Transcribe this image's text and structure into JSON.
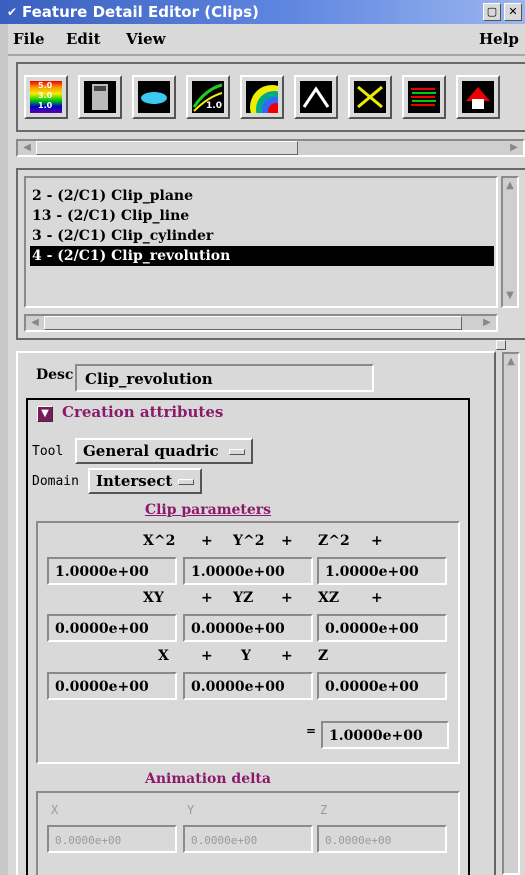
{
  "window": {
    "title": "Feature Detail Editor (Clips)",
    "menu_glyph": "✔",
    "minimize_glyph": "▢",
    "close_glyph": "✕"
  },
  "menubar": {
    "file": "File",
    "edit": "Edit",
    "view": "View",
    "help": "Help"
  },
  "toolbar": {
    "icons": [
      "color-legend-icon",
      "calculator-icon",
      "surface-icon",
      "chart-1-icon",
      "isosurface-icon",
      "arrow-curve-icon",
      "scissors-icon",
      "arrows-icon",
      "upload-icon"
    ],
    "legend_values": [
      "5.0",
      "3.0",
      "1.0"
    ],
    "chart_value": "1.0"
  },
  "list": {
    "items": [
      "2 - (2/C1) Clip_plane",
      "13 - (2/C1) Clip_line",
      "3 - (2/C1) Clip_cylinder",
      "4 - (2/C1) Clip_revolution"
    ],
    "selected_index": 3
  },
  "desc": {
    "label": "Desc",
    "value": "Clip_revolution"
  },
  "creation": {
    "title": "Creation attributes",
    "toggle_glyph": "▼",
    "tool_label": "Tool",
    "tool_value": "General quadric",
    "domain_label": "Domain",
    "domain_value": "Intersect"
  },
  "clip_params": {
    "title": "Clip parameters",
    "row1_labels": [
      "X^2",
      "+",
      "Y^2",
      "+",
      "Z^2",
      "+"
    ],
    "row1_values": [
      "1.0000e+00",
      "1.0000e+00",
      "1.0000e+00"
    ],
    "row2_labels": [
      "XY",
      "+",
      "YZ",
      "+",
      "XZ",
      "+"
    ],
    "row2_values": [
      "0.0000e+00",
      "0.0000e+00",
      "0.0000e+00"
    ],
    "row3_labels": [
      "X",
      "+",
      "Y",
      "+",
      "Z"
    ],
    "row3_values": [
      "0.0000e+00",
      "0.0000e+00",
      "0.0000e+00"
    ],
    "equals": "=",
    "rhs_value": "1.0000e+00"
  },
  "animation": {
    "title": "Animation delta",
    "labels": [
      "X",
      "Y",
      "Z"
    ],
    "values": [
      "0.0000e+00",
      "0.0000e+00",
      "0.0000e+00"
    ]
  }
}
